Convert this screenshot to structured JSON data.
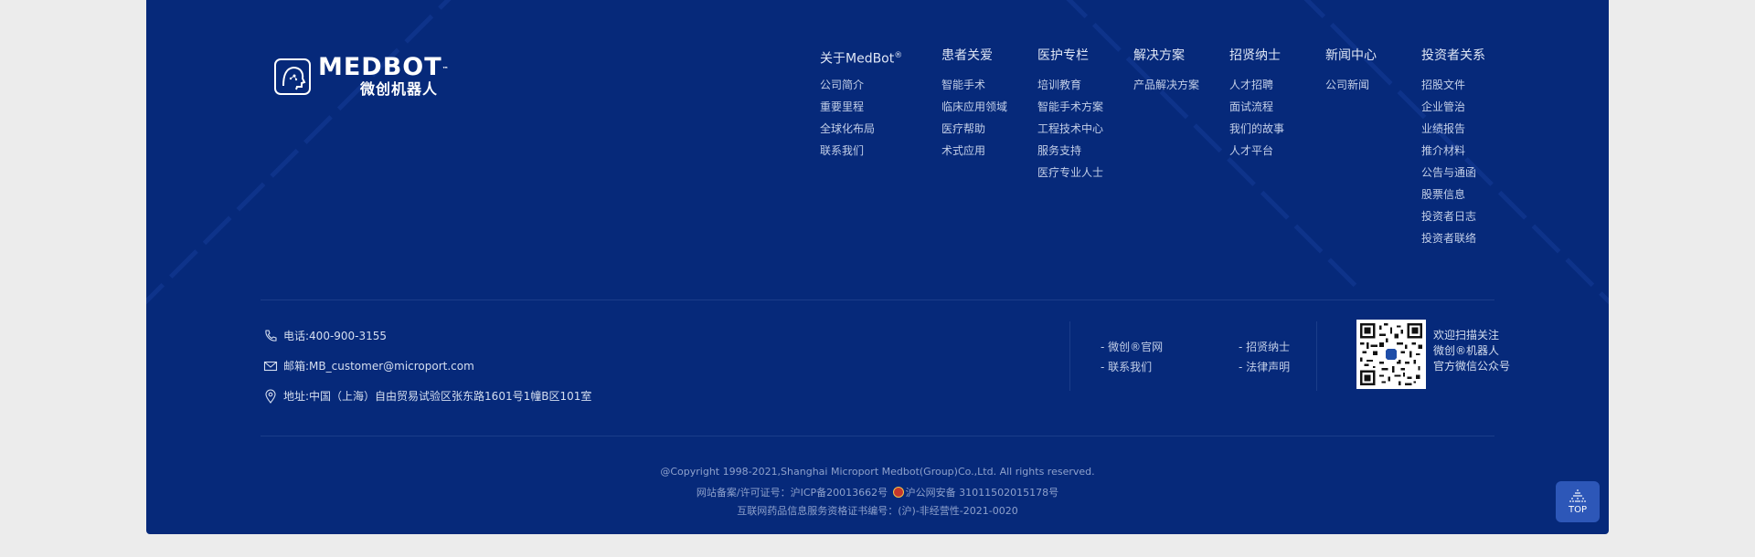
{
  "logo": {
    "brand_en": "MEDBOT",
    "tm": "™",
    "brand_cn": "微创机器人"
  },
  "nav": [
    {
      "title": "关于MedBot",
      "sup": "®",
      "items": [
        "公司简介",
        "重要里程",
        "全球化布局",
        "联系我们"
      ]
    },
    {
      "title": "患者关爱",
      "items": [
        "智能手术",
        "临床应用领域",
        "医疗帮助",
        "术式应用"
      ]
    },
    {
      "title": "医护专栏",
      "items": [
        "培训教育",
        "智能手术方案",
        "工程技术中心",
        "服务支持",
        "医疗专业人士"
      ]
    },
    {
      "title": "解决方案",
      "items": [
        "产品解决方案"
      ]
    },
    {
      "title": "招贤纳士",
      "items": [
        "人才招聘",
        "面试流程",
        "我们的故事",
        "人才平台"
      ]
    },
    {
      "title": "新闻中心",
      "items": [
        "公司新闻"
      ]
    },
    {
      "title": "投资者关系",
      "items": [
        "招股文件",
        "企业管治",
        "业绩报告",
        "推介材料",
        "公告与通函",
        "股票信息",
        "投资者日志",
        "投资者联络"
      ]
    }
  ],
  "contact": {
    "phone": "电话:400-900-3155",
    "email": "邮箱:MB_customer@microport.com",
    "address": "地址:中国（上海）自由贸易试验区张东路1601号1幢B区101室"
  },
  "quick_links": {
    "website": "- 微创®官网",
    "recruit": "- 招贤纳士",
    "contact_us": "- 联系我们",
    "legal": "- 法律声明"
  },
  "wechat": {
    "line1": "欢迎扫描关注",
    "line2": "微创®机器人",
    "line3": "官方微信公众号"
  },
  "copyright": {
    "line1": "@Copyright 1998-2021,Shanghai Microport Medbot(Group)Co.,Ltd. All rights reserved.",
    "icp": "网站备案/许可证号：沪ICP备20013662号",
    "police": "沪公网安备 31011502015178号",
    "line3": "互联网药品信息服务资格证书编号：(沪)-非经营性-2021-0020"
  },
  "top_button": {
    "label": "TOP"
  },
  "colors": {
    "panel": "#06297a",
    "page": "#ececec",
    "top_button": "#2d57b8"
  }
}
